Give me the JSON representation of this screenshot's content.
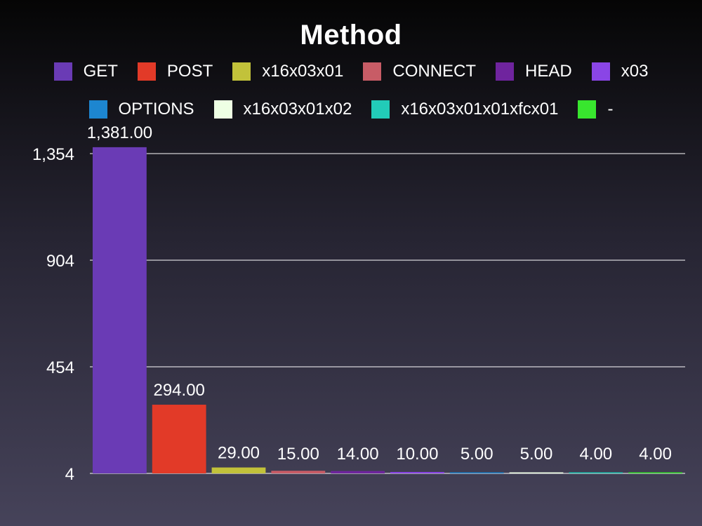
{
  "chart_data": {
    "type": "bar",
    "title": "Method",
    "categories": [
      "GET",
      "POST",
      "x16x03x01",
      "CONNECT",
      "HEAD",
      "x03",
      "OPTIONS",
      "x16x03x01x02",
      "x16x03x01x01xfcx01",
      "-"
    ],
    "values": [
      1381,
      294,
      29,
      15,
      14,
      10,
      5,
      5,
      4,
      4
    ],
    "value_labels": [
      "1,381.00",
      "294.00",
      "29.00",
      "15.00",
      "14.00",
      "10.00",
      "5.00",
      "5.00",
      "4.00",
      "4.00"
    ],
    "colors": [
      "#6a3bb5",
      "#e23a28",
      "#c2c23a",
      "#c85c66",
      "#6f249e",
      "#8a45e6",
      "#1d86d0",
      "#eeffe4",
      "#22cbb8",
      "#38e62e"
    ],
    "y_ticks": [
      4,
      454,
      904,
      1354
    ],
    "y_tick_labels": [
      "4",
      "454",
      "904",
      "1,354"
    ],
    "ylim": [
      4,
      1400
    ],
    "xlabel": "",
    "ylabel": "",
    "grid": true,
    "legend_position": "top"
  }
}
